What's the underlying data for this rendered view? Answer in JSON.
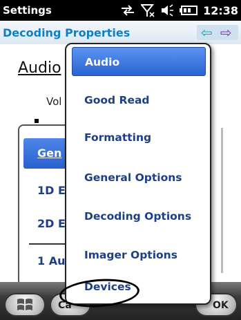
{
  "status_bar": {
    "title": "Settings",
    "time": "12:38",
    "icons": [
      "sync-arrows-icon",
      "signal-off-icon",
      "volume-icon",
      "battery-icon"
    ]
  },
  "header": {
    "title": "Decoding Properties",
    "back_icon": "arrow-left-icon",
    "forward_icon": "arrow-right-icon"
  },
  "background_page": {
    "tab_label": "Audio",
    "volume_label_fragment": "Vol",
    "panel_items": [
      "Gen",
      "1D E",
      "2D E",
      "1 Au"
    ]
  },
  "menu": {
    "items": [
      {
        "label": "Audio",
        "selected": true
      },
      {
        "label": "Good Read",
        "selected": false
      },
      {
        "label": "Formatting",
        "selected": false
      },
      {
        "label": "General Options",
        "selected": false
      },
      {
        "label": "Decoding Options",
        "selected": false
      },
      {
        "label": "Imager Options",
        "selected": false
      },
      {
        "label": "Devices",
        "selected": false
      }
    ]
  },
  "softkeys": {
    "left_fragment": "Ca",
    "right_fragment": "OK"
  },
  "colors": {
    "header_title": "#0f7fc6",
    "menu_text": "#1c3f85",
    "menu_selected": "#2b63d3"
  }
}
